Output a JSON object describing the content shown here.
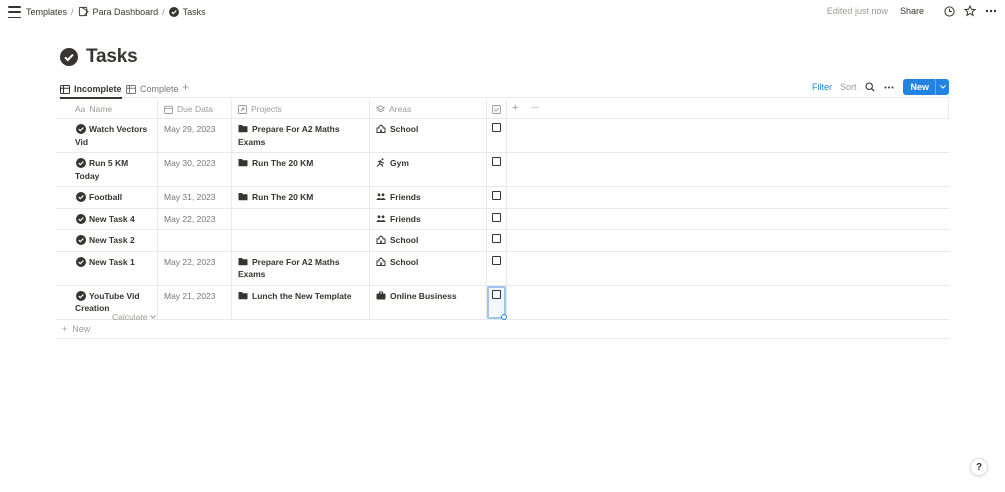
{
  "breadcrumb": {
    "items": [
      "Templates",
      "Para Dashboard",
      "Tasks"
    ],
    "separator": "/"
  },
  "topbar": {
    "edited": "Edited just now",
    "share": "Share"
  },
  "page": {
    "title": "Tasks"
  },
  "views": {
    "tabs": [
      {
        "label": "Incomplete",
        "active": true
      },
      {
        "label": "Complete",
        "active": false
      }
    ],
    "add": "+",
    "filter": "Filter",
    "sort": "Sort",
    "new": "New"
  },
  "table": {
    "columns": {
      "name": "Name",
      "name_prefix": "Aa",
      "due": "Due Data",
      "projects": "Projects",
      "areas": "Areas"
    },
    "rows": [
      {
        "name": "Watch Vectors Vid",
        "due": "May 29, 2023",
        "project": "Prepare For A2 Maths Exams",
        "area": "School",
        "area_icon": "school-icon",
        "checked": false
      },
      {
        "name": "Run 5 KM Today",
        "due": "May 30, 2023",
        "project": "Run The 20 KM",
        "area": "Gym",
        "area_icon": "running-icon",
        "checked": false
      },
      {
        "name": "Football",
        "due": "May 31, 2023",
        "project": "Run The 20 KM",
        "area": "Friends",
        "area_icon": "people-icon",
        "checked": false
      },
      {
        "name": "New Task 4",
        "due": "May 22, 2023",
        "project": "",
        "area": "Friends",
        "area_icon": "people-icon",
        "checked": false
      },
      {
        "name": "New Task 2",
        "due": "",
        "project": "",
        "area": "School",
        "area_icon": "school-icon",
        "checked": false
      },
      {
        "name": "New Task 1",
        "due": "May 22, 2023",
        "project": "Prepare For A2 Maths Exams",
        "area": "School",
        "area_icon": "school-icon",
        "checked": false
      },
      {
        "name": "YouTube Vid Creation",
        "due": "May 21, 2023",
        "project": "Lunch the New Template",
        "area": "Online Business",
        "area_icon": "briefcase-icon",
        "checked": false
      }
    ],
    "new_row": "New",
    "calculate": "Calculate"
  },
  "help": "?",
  "colors": {
    "accent": "#2383e2",
    "text": "#37352f",
    "muted": "#9b9a97",
    "border": "#e9e9e7"
  }
}
